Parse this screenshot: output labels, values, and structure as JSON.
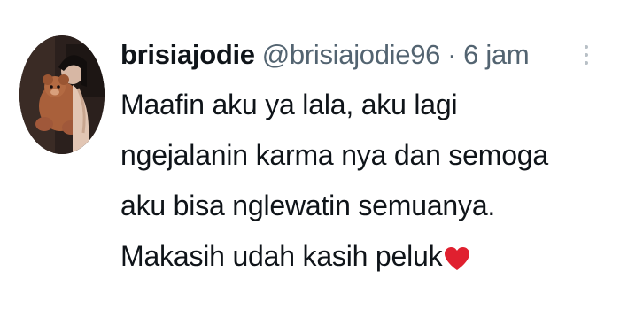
{
  "tweet": {
    "display_name": "brisiajodie",
    "handle": "@brisiajodie96",
    "separator": "·",
    "time": "6 jam",
    "text": "Maafin aku ya lala, aku lagi ngejalanin karma nya dan semoga aku bisa nglewatin semuanya. Makasih udah kasih peluk",
    "emoji": "red-heart-icon"
  },
  "icons": {
    "avatar": "profile-photo",
    "more": "more-options-icon"
  },
  "colors": {
    "text": "#0f1419",
    "secondary": "#536471",
    "heart": "#e0202f"
  }
}
